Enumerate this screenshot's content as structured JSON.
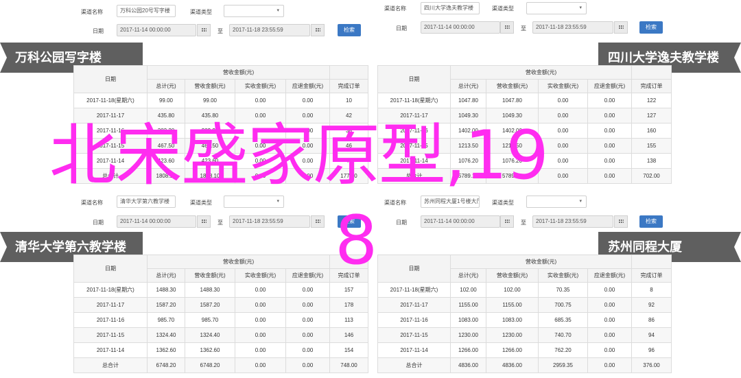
{
  "colors": {
    "banner_bg": "#5f5f5f",
    "button_bg": "#3b78c4",
    "overlay_text": "#ff2cf0"
  },
  "common": {
    "channel_label": "渠道名称",
    "type_label": "渠道类型",
    "date_label": "日期",
    "to_label": "至",
    "start_date": "2017-11-14 00:00:00",
    "end_date": "2017-11-18 23:55:59",
    "search_button": "检索",
    "header_group": "营收金额(元)",
    "header_date": "日期",
    "col_total": "总计(元)",
    "col_revenue": "营收金额(元)",
    "col_actual": "实收金额(元)",
    "col_pending": "应退金额(元)",
    "col_orders": "完成订单"
  },
  "panels": {
    "tl": {
      "channel_value": "万科公园20号写字楼",
      "banner": "万科公园写字楼",
      "rows": [
        {
          "date": "2017-11-18(星期六)",
          "total": "99.00",
          "revenue": "99.00",
          "actual": "0.00",
          "pending": "0.00",
          "orders": "10"
        },
        {
          "date": "2017-11-17",
          "total": "435.80",
          "revenue": "435.80",
          "actual": "0.00",
          "pending": "0.00",
          "orders": "42"
        },
        {
          "date": "2017-11-16",
          "total": "382.20",
          "revenue": "382.20",
          "actual": "0.00",
          "pending": "0.00",
          "orders": "38"
        },
        {
          "date": "2017-11-15",
          "total": "467.50",
          "revenue": "467.50",
          "actual": "0.00",
          "pending": "0.00",
          "orders": "46"
        },
        {
          "date": "2017-11-14",
          "total": "423.60",
          "revenue": "423.60",
          "actual": "0.00",
          "pending": "0.00",
          "orders": "41"
        },
        {
          "date": "总合计",
          "total": "1808.10",
          "revenue": "1808.10",
          "actual": "0.00",
          "pending": "0.00",
          "orders": "177.00"
        }
      ]
    },
    "tr": {
      "channel_value": "四川大学逸夫教学楼",
      "banner": "四川大学逸夫教学楼",
      "rows": [
        {
          "date": "2017-11-18(星期六)",
          "total": "1047.80",
          "revenue": "1047.80",
          "actual": "0.00",
          "pending": "0.00",
          "orders": "122"
        },
        {
          "date": "2017-11-17",
          "total": "1049.30",
          "revenue": "1049.30",
          "actual": "0.00",
          "pending": "0.00",
          "orders": "127"
        },
        {
          "date": "2017-11-16",
          "total": "1402.00",
          "revenue": "1402.00",
          "actual": "0.00",
          "pending": "0.00",
          "orders": "160"
        },
        {
          "date": "2017-11-15",
          "total": "1213.50",
          "revenue": "1213.50",
          "actual": "0.00",
          "pending": "0.00",
          "orders": "155"
        },
        {
          "date": "2017-11-14",
          "total": "1076.20",
          "revenue": "1076.20",
          "actual": "0.00",
          "pending": "0.00",
          "orders": "138"
        },
        {
          "date": "总合计",
          "total": "5789.10",
          "revenue": "5789.10",
          "actual": "0.00",
          "pending": "0.00",
          "orders": "702.00"
        }
      ]
    },
    "bl": {
      "channel_value": "清华大学第六教学楼",
      "banner": "清华大学第六教学楼",
      "rows": [
        {
          "date": "2017-11-18(星期六)",
          "total": "1488.30",
          "revenue": "1488.30",
          "actual": "0.00",
          "pending": "0.00",
          "orders": "157"
        },
        {
          "date": "2017-11-17",
          "total": "1587.20",
          "revenue": "1587.20",
          "actual": "0.00",
          "pending": "0.00",
          "orders": "178"
        },
        {
          "date": "2017-11-16",
          "total": "985.70",
          "revenue": "985.70",
          "actual": "0.00",
          "pending": "0.00",
          "orders": "113"
        },
        {
          "date": "2017-11-15",
          "total": "1324.40",
          "revenue": "1324.40",
          "actual": "0.00",
          "pending": "0.00",
          "orders": "146"
        },
        {
          "date": "2017-11-14",
          "total": "1362.60",
          "revenue": "1362.60",
          "actual": "0.00",
          "pending": "0.00",
          "orders": "154"
        },
        {
          "date": "总合计",
          "total": "6748.20",
          "revenue": "6748.20",
          "actual": "0.00",
          "pending": "0.00",
          "orders": "748.00"
        }
      ]
    },
    "br": {
      "channel_value": "苏州同程大厦1号楼大厅",
      "banner": "苏州同程大厦",
      "rows": [
        {
          "date": "2017-11-18(星期六)",
          "total": "102.00",
          "revenue": "102.00",
          "actual": "70.35",
          "pending": "0.00",
          "orders": "8"
        },
        {
          "date": "2017-11-17",
          "total": "1155.00",
          "revenue": "1155.00",
          "actual": "700.75",
          "pending": "0.00",
          "orders": "92"
        },
        {
          "date": "2017-11-16",
          "total": "1083.00",
          "revenue": "1083.00",
          "actual": "685.35",
          "pending": "0.00",
          "orders": "86"
        },
        {
          "date": "2017-11-15",
          "total": "1230.00",
          "revenue": "1230.00",
          "actual": "740.70",
          "pending": "0.00",
          "orders": "94"
        },
        {
          "date": "2017-11-14",
          "total": "1266.00",
          "revenue": "1266.00",
          "actual": "762.20",
          "pending": "0.00",
          "orders": "96"
        },
        {
          "date": "总合计",
          "total": "4836.00",
          "revenue": "4836.00",
          "actual": "2959.35",
          "pending": "0.00",
          "orders": "376.00"
        }
      ]
    }
  },
  "overlay": {
    "line1": "北宋盛家原型,19",
    "line2": "8"
  }
}
